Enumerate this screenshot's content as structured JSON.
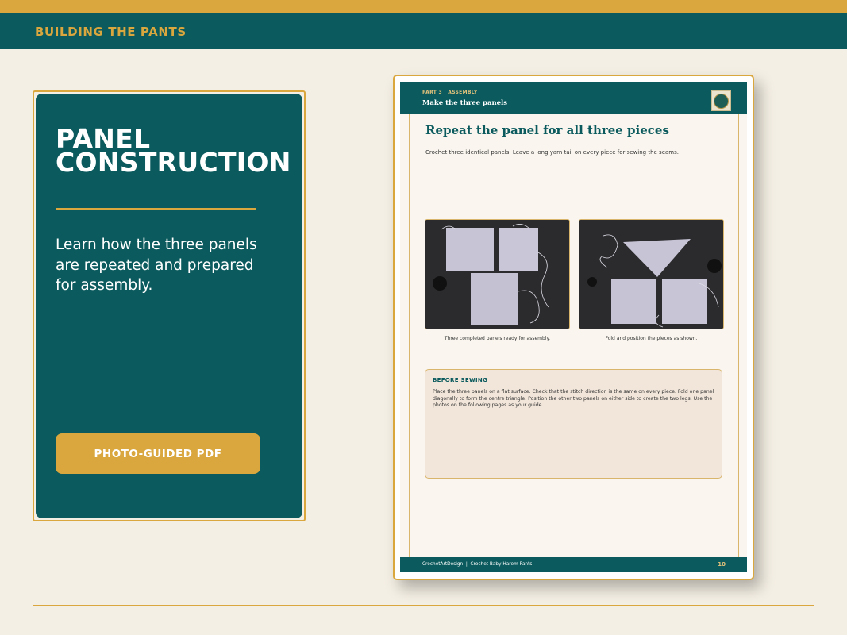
{
  "header": {
    "title": "BUILDING THE PANTS"
  },
  "left_panel": {
    "title": "PANEL CONSTRUCTION",
    "description": "Learn how the three panels are repeated and prepared for assembly.",
    "button_label": "PHOTO-GUIDED PDF"
  },
  "document": {
    "part_label": "PART 3 | ASSEMBLY",
    "subtitle": "Make the three panels",
    "logo_icon": "crochet-art-design-logo",
    "heading": "Repeat the panel for all three pieces",
    "intro": "Crochet three identical panels. Leave a long yarn tail on every piece for sewing the seams.",
    "photos": [
      {
        "caption": "Three completed panels ready for assembly."
      },
      {
        "caption": "Fold and position the pieces as shown."
      }
    ],
    "note": {
      "title": "BEFORE SEWING",
      "body": "Place the three panels on a flat surface. Check that the stitch direction is the same on every piece. Fold one panel diagonally to form the centre triangle. Position the other two panels on either side to create the two legs. Use the photos on the following pages as your guide."
    },
    "footer": {
      "text": "CrochetArtDesign  |  Crochet Baby Harem Pants",
      "page": "10"
    }
  },
  "colors": {
    "teal": "#0b5a5d",
    "gold": "#d9a73e",
    "cream": "#f4efe4"
  }
}
